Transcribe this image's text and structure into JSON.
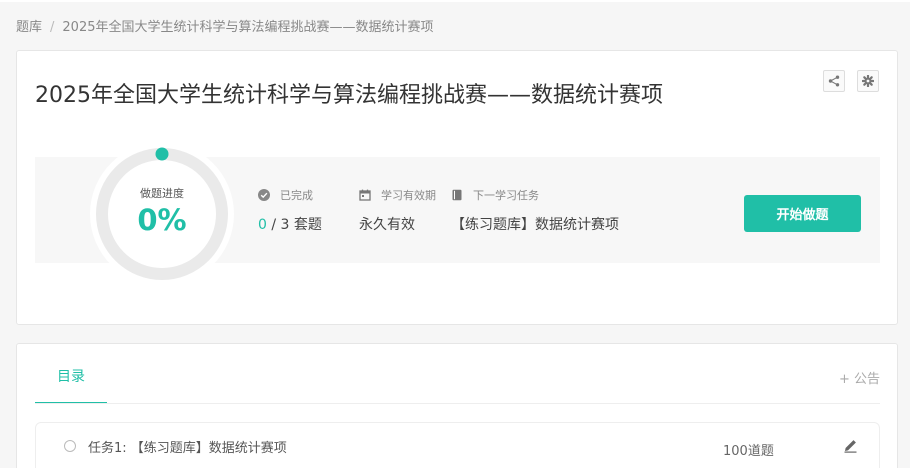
{
  "breadcrumb": {
    "root": "题库",
    "separator": "/",
    "current": "2025年全国大学生统计科学与算法编程挑战赛——数据统计赛项"
  },
  "header": {
    "title": "2025年全国大学生统计科学与算法编程挑战赛——数据统计赛项",
    "share_icon": "share-icon",
    "settings_icon": "gear-icon"
  },
  "progress": {
    "label": "做题进度",
    "percent_text": "0%",
    "fraction": 0
  },
  "stats": {
    "completed": {
      "label": "已完成",
      "icon": "check-circle-icon",
      "done": "0",
      "separator": " / ",
      "total": "3",
      "unit": " 套题"
    },
    "validity": {
      "label": "学习有效期",
      "icon": "calendar-icon",
      "value": "永久有效"
    },
    "next_task": {
      "label": "下一学习任务",
      "icon": "book-icon",
      "value": "【练习题库】数据统计赛项"
    }
  },
  "actions": {
    "start_label": "开始做题"
  },
  "tabs": {
    "catalog_label": "目录",
    "notice_label": "+ 公告"
  },
  "tasks": [
    {
      "title": "任务1: 【练习题库】数据统计赛项",
      "count": "100道题",
      "icon": "edit-icon"
    }
  ],
  "colors": {
    "accent": "#20bfa7",
    "background": "#f6f6f6"
  }
}
